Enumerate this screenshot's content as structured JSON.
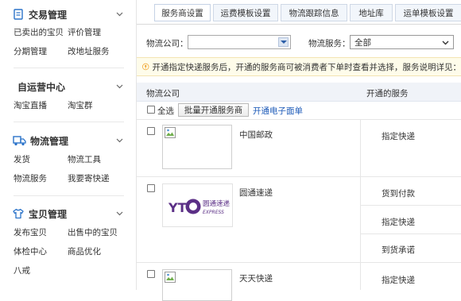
{
  "sidebar": {
    "sections": [
      {
        "title": "交易管理",
        "icon": "document-icon",
        "links": [
          "已卖出的宝贝",
          "评价管理",
          "分期管理",
          "改地址服务"
        ]
      },
      {
        "title": "自运营中心",
        "links": [
          "淘宝直播",
          "淘宝群"
        ]
      },
      {
        "title": "物流管理",
        "icon": "truck-icon",
        "links": [
          "发货",
          "物流工具",
          "物流服务",
          "我要寄快递"
        ]
      },
      {
        "title": "宝贝管理",
        "icon": "shirt-icon",
        "links": [
          "发布宝贝",
          "出售中的宝贝",
          "体检中心",
          "商品优化",
          "八戒"
        ]
      }
    ]
  },
  "tabs": [
    "服务商设置",
    "运费模板设置",
    "物流跟踪信息",
    "地址库",
    "运单模板设置"
  ],
  "filters": {
    "company_label": "物流公司：",
    "company_value": "",
    "service_label": "物流服务：",
    "service_value": "全部"
  },
  "notice": "开通指定快递服务后，开通的服务商可被消费者下单时查看并选择，服务说明详见：",
  "table": {
    "col_company": "物流公司",
    "col_service": "开通的服务",
    "select_all": "全选",
    "batch_button": "批量开通服务商",
    "eface_link": "开通电子面单",
    "rows": [
      {
        "name": "中国邮政",
        "services": [
          "指定快递"
        ]
      },
      {
        "name": "圆通速递",
        "services": [
          "货到付款",
          "指定快递",
          "到货承诺"
        ],
        "logo_text": "圆通速递",
        "logo_sub": "EXPRESS",
        "logo_mark": "YTO"
      },
      {
        "name": "天天快递",
        "services": [
          "指定快递"
        ]
      }
    ]
  },
  "colors": {
    "accent_blue": "#1c5ab8",
    "icon_blue": "#2b73c9",
    "notice_bg": "#fefcea",
    "logo_purple": "#5b2f86"
  }
}
